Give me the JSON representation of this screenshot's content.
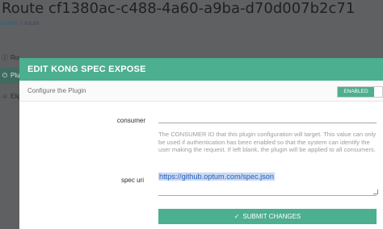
{
  "background": {
    "title": "Route cf1380ac-c488-4a60-a9ba-d70d007b2c71",
    "breadcrumb": {
      "link": "routes",
      "separator": "/",
      "current": "route"
    },
    "sidebar": [
      {
        "icon": "info-icon",
        "label": "Route Details"
      },
      {
        "icon": "plug-icon",
        "label": "Plugins"
      },
      {
        "icon": "users-icon",
        "label": "Eligible consumers"
      }
    ]
  },
  "modal": {
    "title": "EDIT KONG SPEC EXPOSE",
    "configure_label": "Configure the Plugin",
    "toggle_label": "ENABLED",
    "fields": {
      "consumer": {
        "label": "consumer",
        "value": "",
        "help": "The CONSUMER ID that this plugin configuration will target. This value can only be used if authentication has been enabled so that the system can identify the user making the request. If left blank, the plugin will be applied to all consumers."
      },
      "spec_uri": {
        "label": "spec uri",
        "value": "https://github.optum.com/spec.json"
      }
    },
    "submit_label": "SUBMIT CHANGES"
  },
  "colors": {
    "accent": "#4caf8f",
    "overlay": "#5f6062",
    "link": "#2b62b8"
  }
}
